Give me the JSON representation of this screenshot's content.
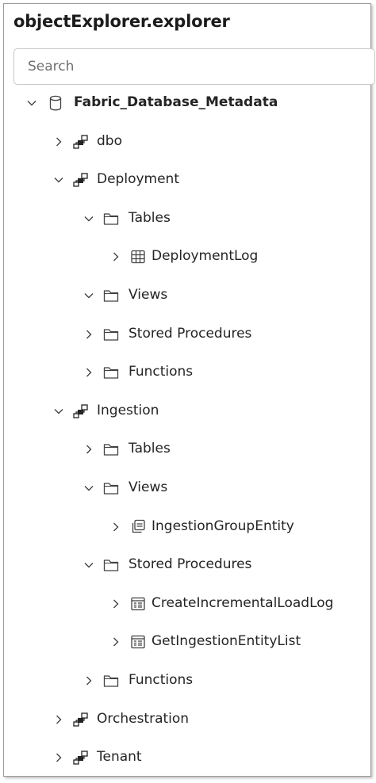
{
  "panel": {
    "title": "objectExplorer.explorer"
  },
  "search": {
    "placeholder": "Search"
  },
  "tree": [
    {
      "label": "Fabric_Database_Metadata",
      "level": 0,
      "expanded": true,
      "icon": "database-icon",
      "bold": true
    },
    {
      "label": "dbo",
      "level": 1,
      "expanded": false,
      "icon": "schema-icon"
    },
    {
      "label": "Deployment",
      "level": 1,
      "expanded": true,
      "icon": "schema-icon"
    },
    {
      "label": "Tables",
      "level": 2,
      "expanded": true,
      "icon": "folder-icon"
    },
    {
      "label": "DeploymentLog",
      "level": 3,
      "expanded": false,
      "icon": "table-icon"
    },
    {
      "label": "Views",
      "level": 2,
      "expanded": true,
      "icon": "folder-icon"
    },
    {
      "label": "Stored Procedures",
      "level": 2,
      "expanded": false,
      "icon": "folder-icon"
    },
    {
      "label": "Functions",
      "level": 2,
      "expanded": false,
      "icon": "folder-icon"
    },
    {
      "label": "Ingestion",
      "level": 1,
      "expanded": true,
      "icon": "schema-icon"
    },
    {
      "label": "Tables",
      "level": 2,
      "expanded": false,
      "icon": "folder-icon"
    },
    {
      "label": "Views",
      "level": 2,
      "expanded": true,
      "icon": "folder-icon"
    },
    {
      "label": "IngestionGroupEntity",
      "level": 3,
      "expanded": false,
      "icon": "view-icon"
    },
    {
      "label": "Stored Procedures",
      "level": 2,
      "expanded": true,
      "icon": "folder-icon"
    },
    {
      "label": "CreateIncrementalLoadLog",
      "level": 3,
      "expanded": false,
      "icon": "procedure-icon"
    },
    {
      "label": "GetIngestionEntityList",
      "level": 3,
      "expanded": false,
      "icon": "procedure-icon"
    },
    {
      "label": "Functions",
      "level": 2,
      "expanded": false,
      "icon": "folder-icon"
    },
    {
      "label": "Orchestration",
      "level": 1,
      "expanded": false,
      "icon": "schema-icon"
    },
    {
      "label": "Tenant",
      "level": 1,
      "expanded": false,
      "icon": "schema-icon"
    }
  ]
}
